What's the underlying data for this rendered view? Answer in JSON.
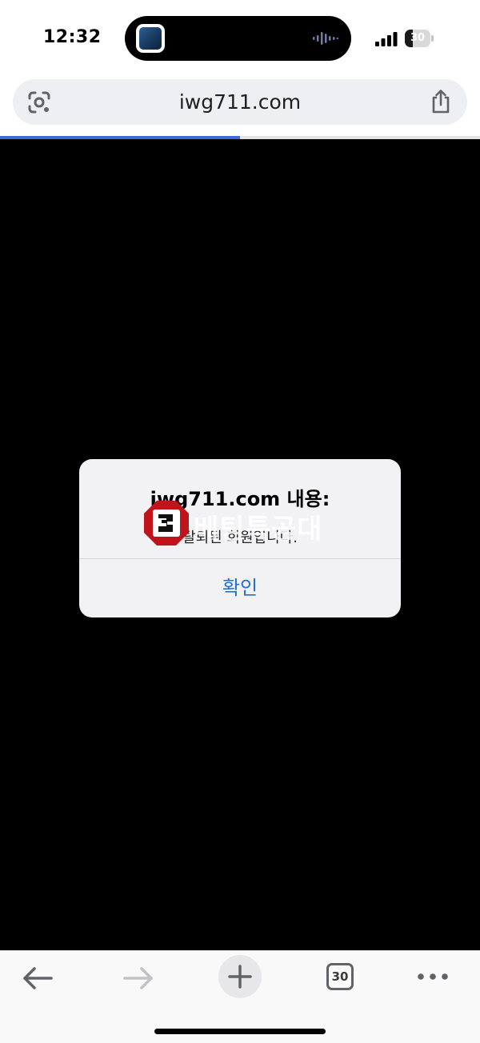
{
  "status_bar": {
    "time": "12:32",
    "battery_level": "30"
  },
  "address_bar": {
    "url": "iwg711.com"
  },
  "page_load_progress_percent": 50,
  "alert": {
    "title": "iwg711.com 내용:",
    "message": "탈퇴된 회원입니다.",
    "confirm_label": "확인"
  },
  "watermark": {
    "text": "베팅특공대"
  },
  "toolbar": {
    "tab_count": "30"
  },
  "icons": {
    "island_app": "media-app-icon",
    "island_activity": "audio-waveform-icon",
    "signal": "cellular-signal-icon",
    "lens": "google-lens-icon",
    "share": "share-icon",
    "back": "arrow-left-icon",
    "forward": "arrow-right-icon",
    "new_tab": "plus-icon",
    "tabs": "tab-switcher-icon",
    "menu": "more-horizontal-icon"
  },
  "colors": {
    "accent_blue": "#1f6fd6",
    "progress_blue": "#3f6bd6",
    "watermark_red": "#c0141c"
  }
}
